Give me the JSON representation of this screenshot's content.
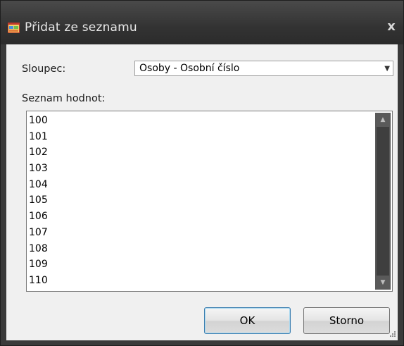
{
  "window": {
    "title": "Přidat ze seznamu",
    "close_glyph": "x",
    "icon": "app-window-icon"
  },
  "form": {
    "column_label": "Sloupec:",
    "column_selected": "Osoby - Osobní číslo",
    "values_label": "Seznam hodnot:",
    "values": [
      "100",
      "101",
      "102",
      "103",
      "104",
      "105",
      "106",
      "107",
      "108",
      "109",
      "110"
    ]
  },
  "buttons": {
    "ok_label": "OK",
    "cancel_label": "Storno"
  },
  "colors": {
    "titlebar": "#333333",
    "client": "#f0f0f0",
    "scrollbar": "#5a5a5a"
  }
}
